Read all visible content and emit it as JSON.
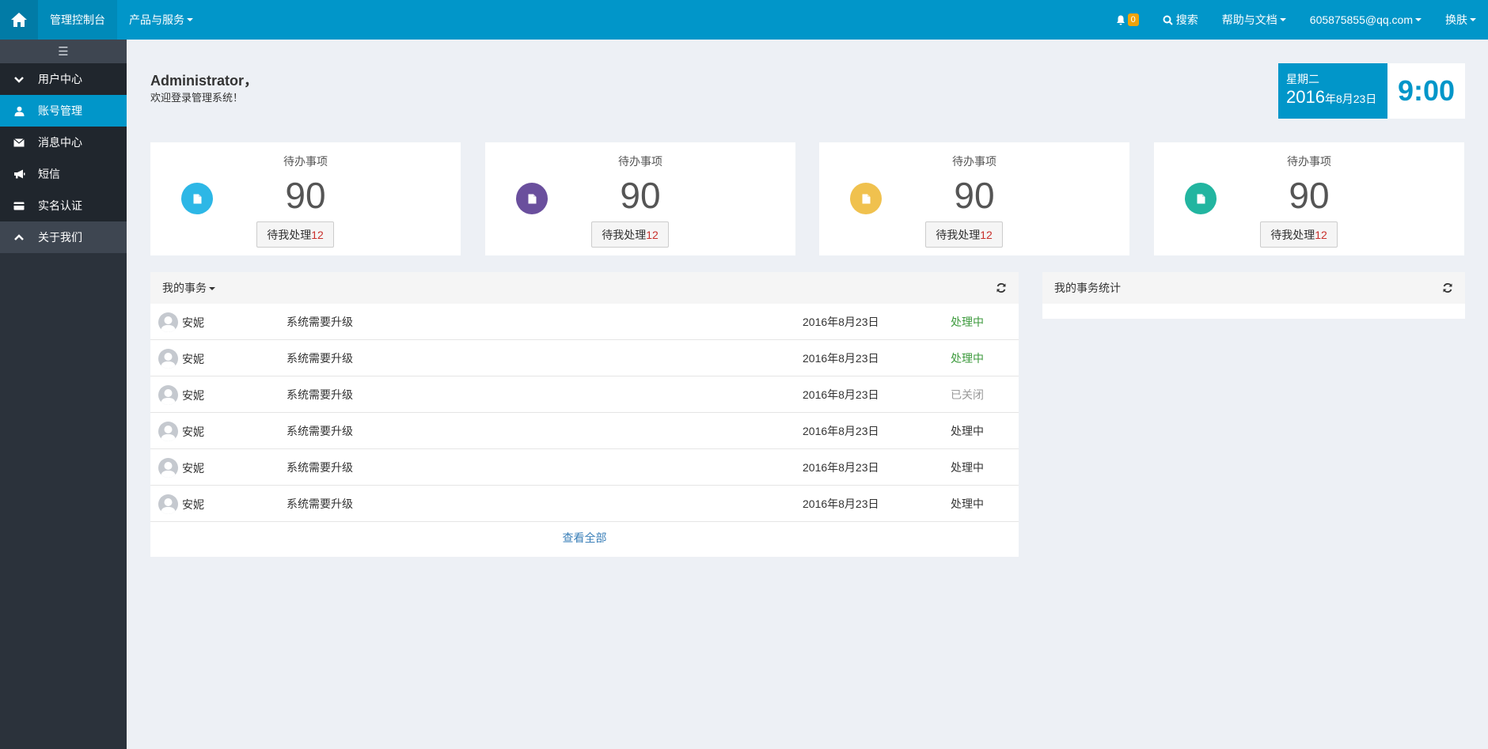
{
  "topbar": {
    "console": "管理控制台",
    "products": "产品与服务",
    "notify_count": "0",
    "search": "搜索",
    "help": "帮助与文档",
    "user": "605875855@qq.com",
    "skin": "换肤"
  },
  "sidebar": {
    "toggle": "☰",
    "items": [
      {
        "label": "用户中心",
        "icon": "chevron-down-icon"
      },
      {
        "label": "账号管理",
        "icon": "user-icon"
      },
      {
        "label": "消息中心",
        "icon": "envelope-icon"
      },
      {
        "label": "短信",
        "icon": "bullhorn-icon"
      },
      {
        "label": "实名认证",
        "icon": "credit-card-icon"
      },
      {
        "label": "关于我们",
        "icon": "chevron-up-icon"
      }
    ]
  },
  "greeting": {
    "name": "Administrator，",
    "welcome": "欢迎登录管理系统！"
  },
  "datetime": {
    "weekday": "星期二",
    "year": "2016",
    "monthday": "年8月23日",
    "time": "9:00"
  },
  "cards": [
    {
      "title": "待办事项",
      "value": "90",
      "btn": "待我处理",
      "count": "12",
      "color": "#2db7e6"
    },
    {
      "title": "待办事项",
      "value": "90",
      "btn": "待我处理",
      "count": "12",
      "color": "#6a4f9d"
    },
    {
      "title": "待办事项",
      "value": "90",
      "btn": "待我处理",
      "count": "12",
      "color": "#f0c14e"
    },
    {
      "title": "待办事项",
      "value": "90",
      "btn": "待我处理",
      "count": "12",
      "color": "#22b5a0"
    }
  ],
  "tasks": {
    "title": "我的事务",
    "rows": [
      {
        "name": "安妮",
        "subject": "系统需要升级",
        "date": "2016年8月23日",
        "status": "处理中"
      },
      {
        "name": "安妮",
        "subject": "系统需要升级",
        "date": "2016年8月23日",
        "status": "处理中"
      },
      {
        "name": "安妮",
        "subject": "系统需要升级",
        "date": "2016年8月23日",
        "status": "已关闭"
      },
      {
        "name": "安妮",
        "subject": "系统需要升级",
        "date": "2016年8月23日",
        "status": "处理中"
      },
      {
        "name": "安妮",
        "subject": "系统需要升级",
        "date": "2016年8月23日",
        "status": "处理中"
      },
      {
        "name": "安妮",
        "subject": "系统需要升级",
        "date": "2016年8月23日",
        "status": "处理中"
      }
    ],
    "view_all": "查看全部"
  },
  "stats": {
    "title": "我的事务统计"
  },
  "colors": {
    "primary": "#0196c9",
    "sidebar": "#2b323b"
  }
}
